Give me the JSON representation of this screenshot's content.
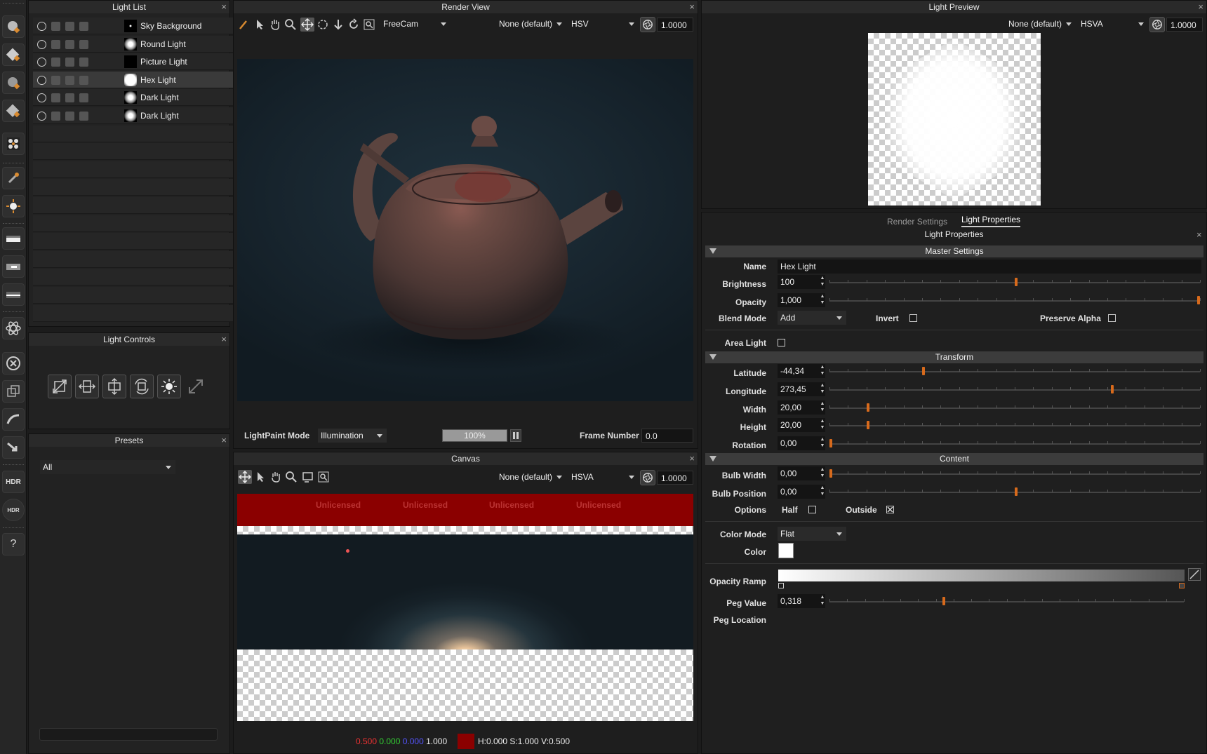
{
  "light_list": {
    "title": "Light List",
    "items": [
      {
        "label": "Sky Background",
        "thumb": "star",
        "selected": false
      },
      {
        "label": "Round Light",
        "thumb": "glow",
        "selected": false
      },
      {
        "label": "Picture Light",
        "thumb": "black",
        "selected": false
      },
      {
        "label": "Hex Light",
        "thumb": "white",
        "selected": true
      },
      {
        "label": "Dark Light",
        "thumb": "glow",
        "selected": false
      },
      {
        "label": "Dark Light",
        "thumb": "glow",
        "selected": false
      }
    ]
  },
  "light_controls": {
    "title": "Light Controls"
  },
  "presets": {
    "title": "Presets",
    "filter": "All"
  },
  "render_view": {
    "title": "Render View",
    "camera": "FreeCam",
    "lut": "None (default)",
    "colorspace": "HSV",
    "exposure": "1.0000",
    "lightpaint_mode_label": "LightPaint Mode",
    "lightpaint_mode": "Illumination",
    "progress": "100%",
    "progress_value": 1.0,
    "frame_number_label": "Frame Number",
    "frame_number": "0.0"
  },
  "canvas": {
    "title": "Canvas",
    "lut": "None (default)",
    "colorspace": "HSVA",
    "exposure": "1.0000",
    "watermark": [
      "Unlicensed",
      "Unlicensed",
      "Unlicensed",
      "Unlicensed"
    ],
    "status": {
      "r": "0.500",
      "g": "0.000",
      "b": "0.000",
      "a": "1.000",
      "swatch": "#8b0000",
      "hsv": "H:0.000 S:1.000 V:0.500"
    }
  },
  "light_preview": {
    "title": "Light Preview",
    "lut": "None (default)",
    "colorspace": "HSVA",
    "exposure": "1.0000"
  },
  "properties": {
    "tabs": [
      "Render Settings",
      "Light Properties"
    ],
    "active_tab": 1,
    "title": "Light Properties",
    "master": {
      "title": "Master Settings",
      "name_label": "Name",
      "name": "Hex Light",
      "brightness_label": "Brightness",
      "brightness": "100",
      "brightness_pos": 0.5,
      "opacity_label": "Opacity",
      "opacity": "1,000",
      "opacity_pos": 1.0,
      "blend_mode_label": "Blend Mode",
      "blend_mode": "Add",
      "invert_label": "Invert",
      "invert": false,
      "preserve_alpha_label": "Preserve Alpha",
      "preserve_alpha": false,
      "area_light_label": "Area Light",
      "area_light": false
    },
    "transform": {
      "title": "Transform",
      "latitude_label": "Latitude",
      "latitude": "-44,34",
      "latitude_pos": 0.25,
      "longitude_label": "Longitude",
      "longitude": "273,45",
      "longitude_pos": 0.76,
      "width_label": "Width",
      "width": "20,00",
      "width_pos": 0.1,
      "height_label": "Height",
      "height": "20,00",
      "height_pos": 0.1,
      "rotation_label": "Rotation",
      "rotation": "0,00",
      "rotation_pos": 0.0
    },
    "content": {
      "title": "Content",
      "bulb_width_label": "Bulb Width",
      "bulb_width": "0,00",
      "bulb_width_pos": 0.0,
      "bulb_position_label": "Bulb Position",
      "bulb_position": "0,00",
      "bulb_position_pos": 0.5,
      "options_label": "Options",
      "half_label": "Half",
      "half": false,
      "outside_label": "Outside",
      "outside": true,
      "color_mode_label": "Color Mode",
      "color_mode": "Flat",
      "color_label": "Color",
      "color": "#ffffff",
      "opacity_ramp_label": "Opacity Ramp",
      "peg_value_label": "Peg Value",
      "peg_value": "0,318",
      "peg_value_pos": 0.318,
      "peg_location_label": "Peg Location"
    }
  },
  "accent": "#d76a1c"
}
